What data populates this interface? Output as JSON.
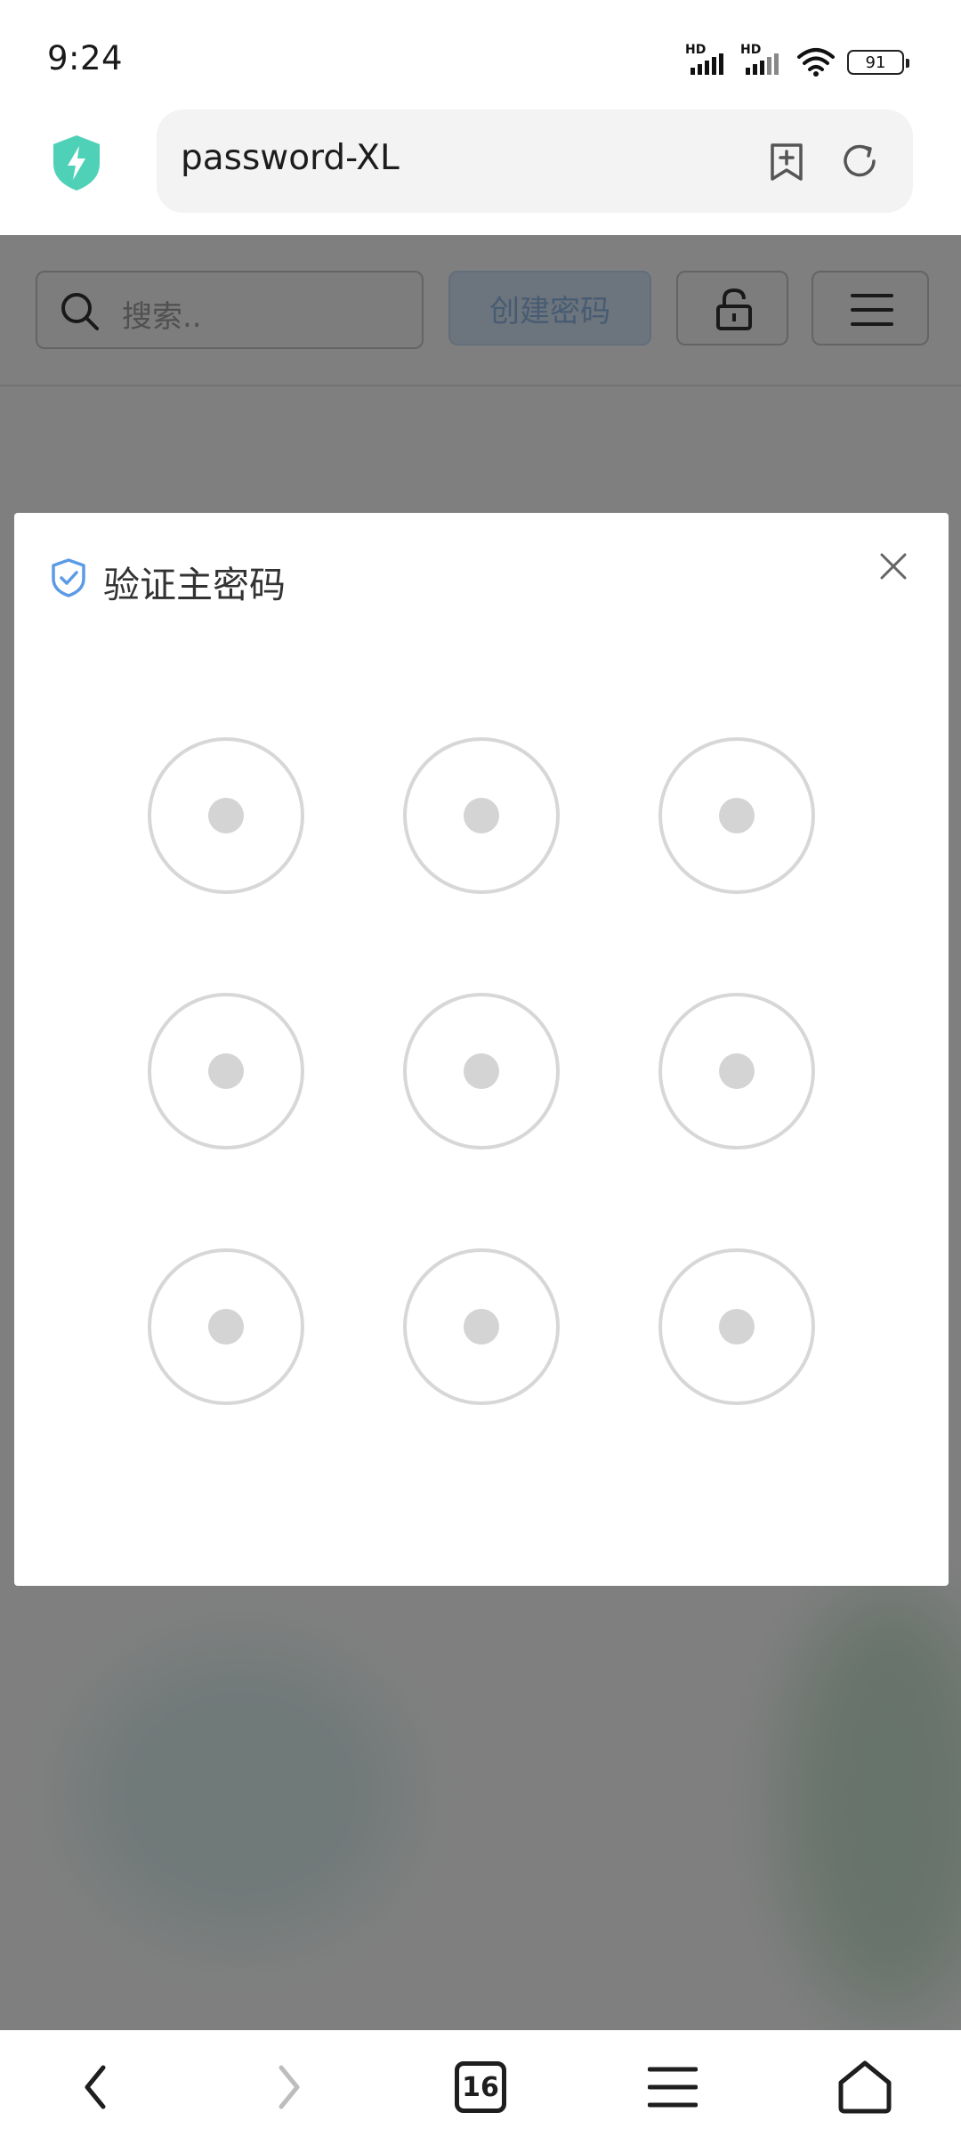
{
  "status_bar": {
    "time": "9:24",
    "network_label_1": "HD",
    "network_label_2": "HD",
    "battery": "91"
  },
  "browser": {
    "url": "password-XL",
    "tab_count": "16"
  },
  "page": {
    "search_placeholder": "搜索..",
    "create_button_label": "创建密码"
  },
  "modal": {
    "title": "验证主密码",
    "pattern_node_count": 9
  },
  "icons": {
    "shield": "shield-icon",
    "bookmark_add": "bookmark-add-icon",
    "refresh": "refresh-icon",
    "search": "search-icon",
    "lock": "unlock-icon",
    "menu": "hamburger-icon",
    "close": "close-icon",
    "back": "back-icon",
    "forward": "forward-icon",
    "home": "home-icon"
  },
  "colors": {
    "shield_accent": "#4fd1b8",
    "primary_blue": "#5b9be6",
    "overlay": "rgba(0,0,0,0.5)"
  }
}
